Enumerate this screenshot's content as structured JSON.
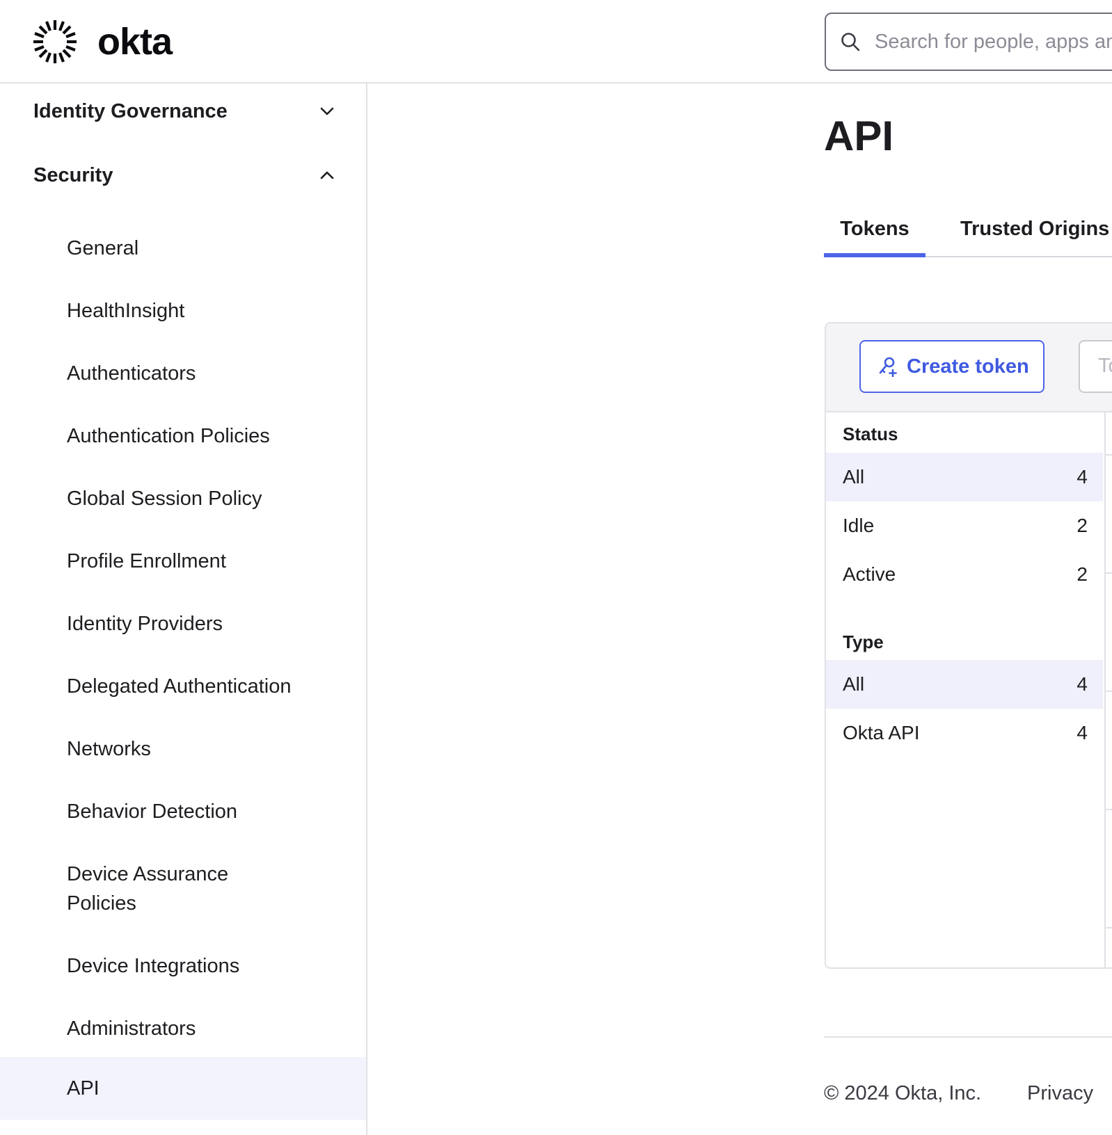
{
  "brand": {
    "name": "okta",
    "accent": "#4c64e8",
    "active_bg": "#f2f3fd"
  },
  "header": {
    "search_placeholder": "Search for people, apps and groups"
  },
  "sidebar": {
    "sections": [
      {
        "label": "Identity Governance",
        "expanded": false,
        "icon": "chevron-down-icon"
      },
      {
        "label": "Security",
        "expanded": true,
        "icon": "chevron-up-icon"
      }
    ],
    "items": [
      {
        "label": "General"
      },
      {
        "label": "HealthInsight"
      },
      {
        "label": "Authenticators"
      },
      {
        "label": "Authentication Policies"
      },
      {
        "label": "Global Session Policy"
      },
      {
        "label": "Profile Enrollment"
      },
      {
        "label": "Identity Providers"
      },
      {
        "label": "Delegated Authentication"
      },
      {
        "label": "Networks"
      },
      {
        "label": "Behavior Detection"
      },
      {
        "label": "Device Assurance Policies"
      },
      {
        "label": "Device Integrations"
      },
      {
        "label": "Administrators"
      },
      {
        "label": "API",
        "active": true
      }
    ]
  },
  "main": {
    "title": "API",
    "tabs": [
      {
        "label": "Tokens",
        "active": true
      },
      {
        "label": "Trusted Origins",
        "active": false
      }
    ],
    "toolbar": {
      "create_label": "Create token",
      "create_icon": "key-plus-icon",
      "filter_placeholder": "Token"
    },
    "filters": {
      "status": {
        "title": "Status",
        "options": [
          {
            "name": "All",
            "count": "4",
            "selected": true
          },
          {
            "name": "Idle",
            "count": "2",
            "selected": false
          },
          {
            "name": "Active",
            "count": "2",
            "selected": false
          }
        ]
      },
      "type": {
        "title": "Type",
        "options": [
          {
            "name": "All",
            "count": "4",
            "selected": true
          },
          {
            "name": "Okta API",
            "count": "4",
            "selected": false
          }
        ]
      }
    }
  },
  "footer": {
    "copyright": "© 2024 Okta, Inc.",
    "privacy": "Privacy"
  }
}
